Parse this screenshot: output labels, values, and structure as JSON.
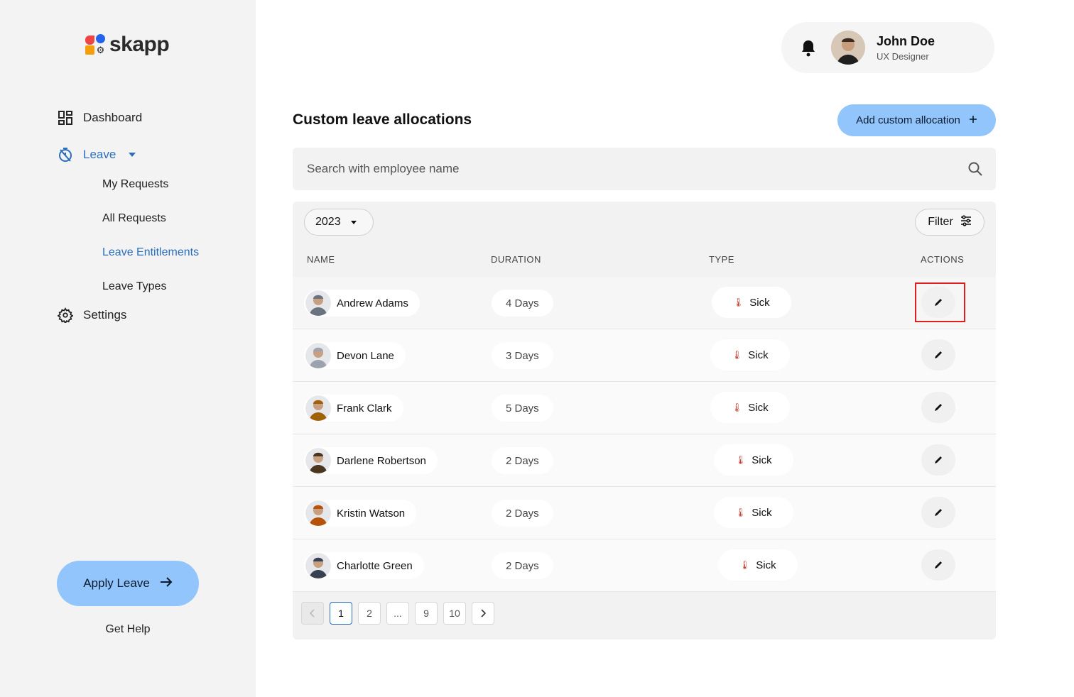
{
  "app": {
    "logo_text": "skapp"
  },
  "sidebar": {
    "items": [
      {
        "label": "Dashboard"
      },
      {
        "label": "Leave"
      },
      {
        "label": "Settings"
      }
    ],
    "leave_subitems": [
      {
        "label": "My Requests"
      },
      {
        "label": "All Requests"
      },
      {
        "label": "Leave Entitlements"
      },
      {
        "label": "Leave Types"
      }
    ],
    "apply_label": "Apply Leave",
    "help_label": "Get Help"
  },
  "profile": {
    "name": "John Doe",
    "role": "UX Designer"
  },
  "main": {
    "title": "Custom leave allocations",
    "add_button_label": "Add custom allocation",
    "search_placeholder": "Search with employee name",
    "year": "2023",
    "filter_label": "Filter",
    "columns": [
      "NAME",
      "DURATION",
      "TYPE",
      "ACTIONS"
    ],
    "rows": [
      {
        "name": "Andrew Adams",
        "duration": "4 Days",
        "type": "Sick",
        "avatar_color": "#6b7280"
      },
      {
        "name": "Devon Lane",
        "duration": "3 Days",
        "type": "Sick",
        "avatar_color": "#9ca3af"
      },
      {
        "name": "Frank Clark",
        "duration": "5 Days",
        "type": "Sick",
        "avatar_color": "#a16207"
      },
      {
        "name": "Darlene Robertson",
        "duration": "2 Days",
        "type": "Sick",
        "avatar_color": "#4b3621"
      },
      {
        "name": "Kristin Watson",
        "duration": "2 Days",
        "type": "Sick",
        "avatar_color": "#b45309"
      },
      {
        "name": "Charlotte Green",
        "duration": "2 Days",
        "type": "Sick",
        "avatar_color": "#374151"
      }
    ],
    "pagination": [
      "1",
      "2",
      "...",
      "9",
      "10"
    ]
  },
  "colors": {
    "accent": "#2a6fbd",
    "button_bg": "#93c5fd",
    "highlight": "#e11d1d"
  }
}
